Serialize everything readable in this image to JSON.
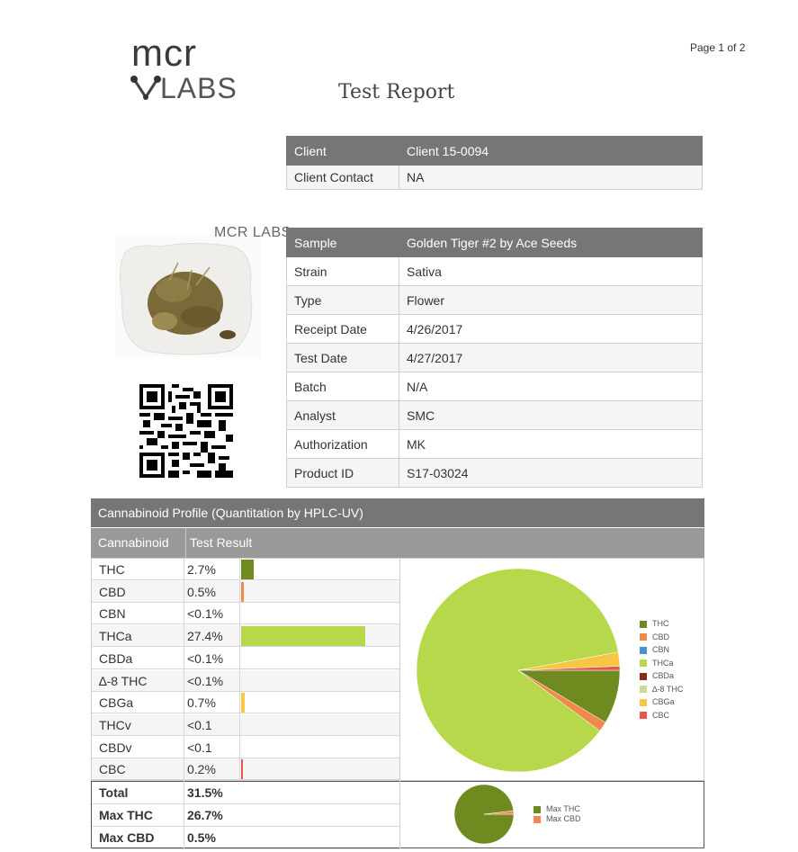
{
  "header": {
    "logo_top": "mcr",
    "logo_bottom": "LABS",
    "page": "Page 1 of 2",
    "title": "Test Report"
  },
  "client_table": [
    {
      "key": "Client",
      "value": "Client 15-0094"
    },
    {
      "key": "Client Contact",
      "value": "NA"
    }
  ],
  "sample_table": [
    {
      "key": "Sample",
      "value": "Golden Tiger #2 by Ace Seeds"
    },
    {
      "key": "Strain",
      "value": "Sativa"
    },
    {
      "key": "Type",
      "value": "Flower"
    },
    {
      "key": "Receipt Date",
      "value": "4/26/2017"
    },
    {
      "key": "Test Date",
      "value": "4/27/2017"
    },
    {
      "key": "Batch",
      "value": "N/A"
    },
    {
      "key": "Analyst",
      "value": "SMC"
    },
    {
      "key": "Authorization",
      "value": "MK"
    },
    {
      "key": "Product ID",
      "value": "S17-03024"
    }
  ],
  "photo_watermark": "MCR LABS",
  "profile": {
    "title": "Cannabinoid Profile (Quantitation by HPLC-UV)",
    "col_name": "Cannabinoid",
    "col_result": "Test Result",
    "rows": [
      {
        "name": "THC",
        "result": "2.7%",
        "value": 2.7,
        "color": "#6f8a1f"
      },
      {
        "name": "CBD",
        "result": "0.5%",
        "value": 0.5,
        "color": "#f08a4b"
      },
      {
        "name": "CBN",
        "result": "<0.1%",
        "value": 0,
        "color": "#4a90d9"
      },
      {
        "name": "THCa",
        "result": "27.4%",
        "value": 27.4,
        "color": "#b7d84b"
      },
      {
        "name": "CBDa",
        "result": "<0.1%",
        "value": 0,
        "color": "#8b2a1a"
      },
      {
        "name": "∆-8 THC",
        "result": "<0.1%",
        "value": 0,
        "color": "#c9d99a"
      },
      {
        "name": "CBGa",
        "result": "0.7%",
        "value": 0.7,
        "color": "#f7c744"
      },
      {
        "name": "THCv",
        "result": "<0.1",
        "value": 0,
        "color": "#999999"
      },
      {
        "name": "CBDv",
        "result": "<0.1",
        "value": 0,
        "color": "#999999"
      },
      {
        "name": "CBC",
        "result": "0.2%",
        "value": 0.2,
        "color": "#e8554e"
      }
    ],
    "totals": [
      {
        "name": "Total",
        "value": "31.5%"
      },
      {
        "name": "Max THC",
        "value": "26.7%"
      },
      {
        "name": "Max CBD",
        "value": "0.5%"
      }
    ]
  },
  "chart_data": [
    {
      "type": "pie",
      "series": [
        {
          "name": "THC",
          "value": 2.7,
          "color": "#6f8a1f"
        },
        {
          "name": "CBD",
          "value": 0.5,
          "color": "#f08a4b"
        },
        {
          "name": "CBN",
          "value": 0,
          "color": "#4a90d9"
        },
        {
          "name": "THCa",
          "value": 27.4,
          "color": "#b7d84b"
        },
        {
          "name": "CBDa",
          "value": 0,
          "color": "#8b2a1a"
        },
        {
          "name": "∆-8 THC",
          "value": 0,
          "color": "#c9d99a"
        },
        {
          "name": "CBGa",
          "value": 0.7,
          "color": "#f7c744"
        },
        {
          "name": "CBC",
          "value": 0.2,
          "color": "#e8554e"
        }
      ],
      "legend": "right"
    },
    {
      "type": "pie",
      "series": [
        {
          "name": "Max THC",
          "value": 26.7,
          "color": "#6f8a1f"
        },
        {
          "name": "Max CBD",
          "value": 0.5,
          "color": "#f08a4b"
        }
      ],
      "legend": "right"
    }
  ]
}
